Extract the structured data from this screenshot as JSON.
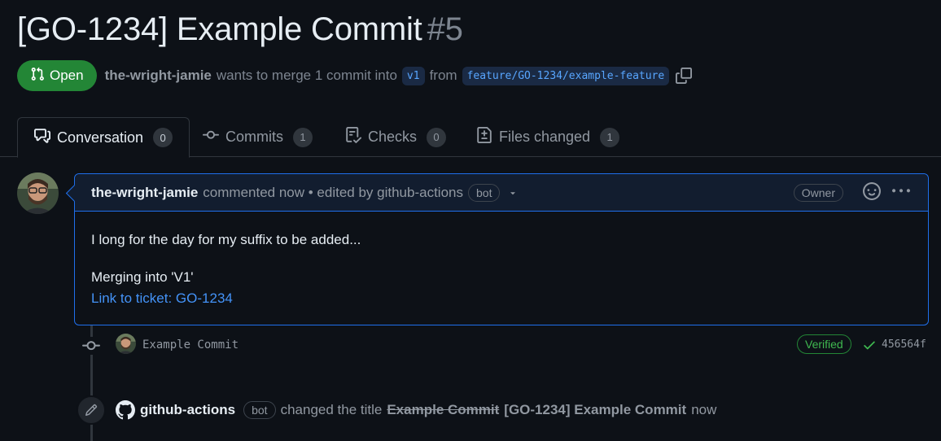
{
  "pr": {
    "title": "[GO-1234] Example Commit",
    "number": "#5",
    "state": "Open",
    "author": "the-wright-jamie",
    "merge_text": "wants to merge 1 commit into",
    "base_branch": "v1",
    "from_text": "from",
    "head_branch": "feature/GO-1234/example-feature"
  },
  "tabs": [
    {
      "label": "Conversation",
      "count": "0",
      "icon": "conversation-icon"
    },
    {
      "label": "Commits",
      "count": "1",
      "icon": "commit-icon"
    },
    {
      "label": "Checks",
      "count": "0",
      "icon": "checklist-icon"
    },
    {
      "label": "Files changed",
      "count": "1",
      "icon": "file-diff-icon"
    }
  ],
  "comment": {
    "author": "the-wright-jamie",
    "meta": "commented now • edited by github-actions",
    "bot_label": "bot",
    "owner_label": "Owner",
    "body_line1": "I long for the day for my suffix to be added...",
    "body_line2": "Merging into 'V1'",
    "link_text": "Link to ticket: GO-1234"
  },
  "commit": {
    "message": "Example Commit",
    "verified_label": "Verified",
    "sha": "456564f"
  },
  "event": {
    "actor": "github-actions",
    "bot_label": "bot",
    "action": "changed the title",
    "old_title": "Example Commit",
    "new_title": "[GO-1234] Example Commit",
    "time": "now"
  },
  "colors": {
    "background": "#0d1117",
    "accent_blue": "#1f6feb",
    "open_green": "#238636",
    "link": "#4493f8"
  }
}
